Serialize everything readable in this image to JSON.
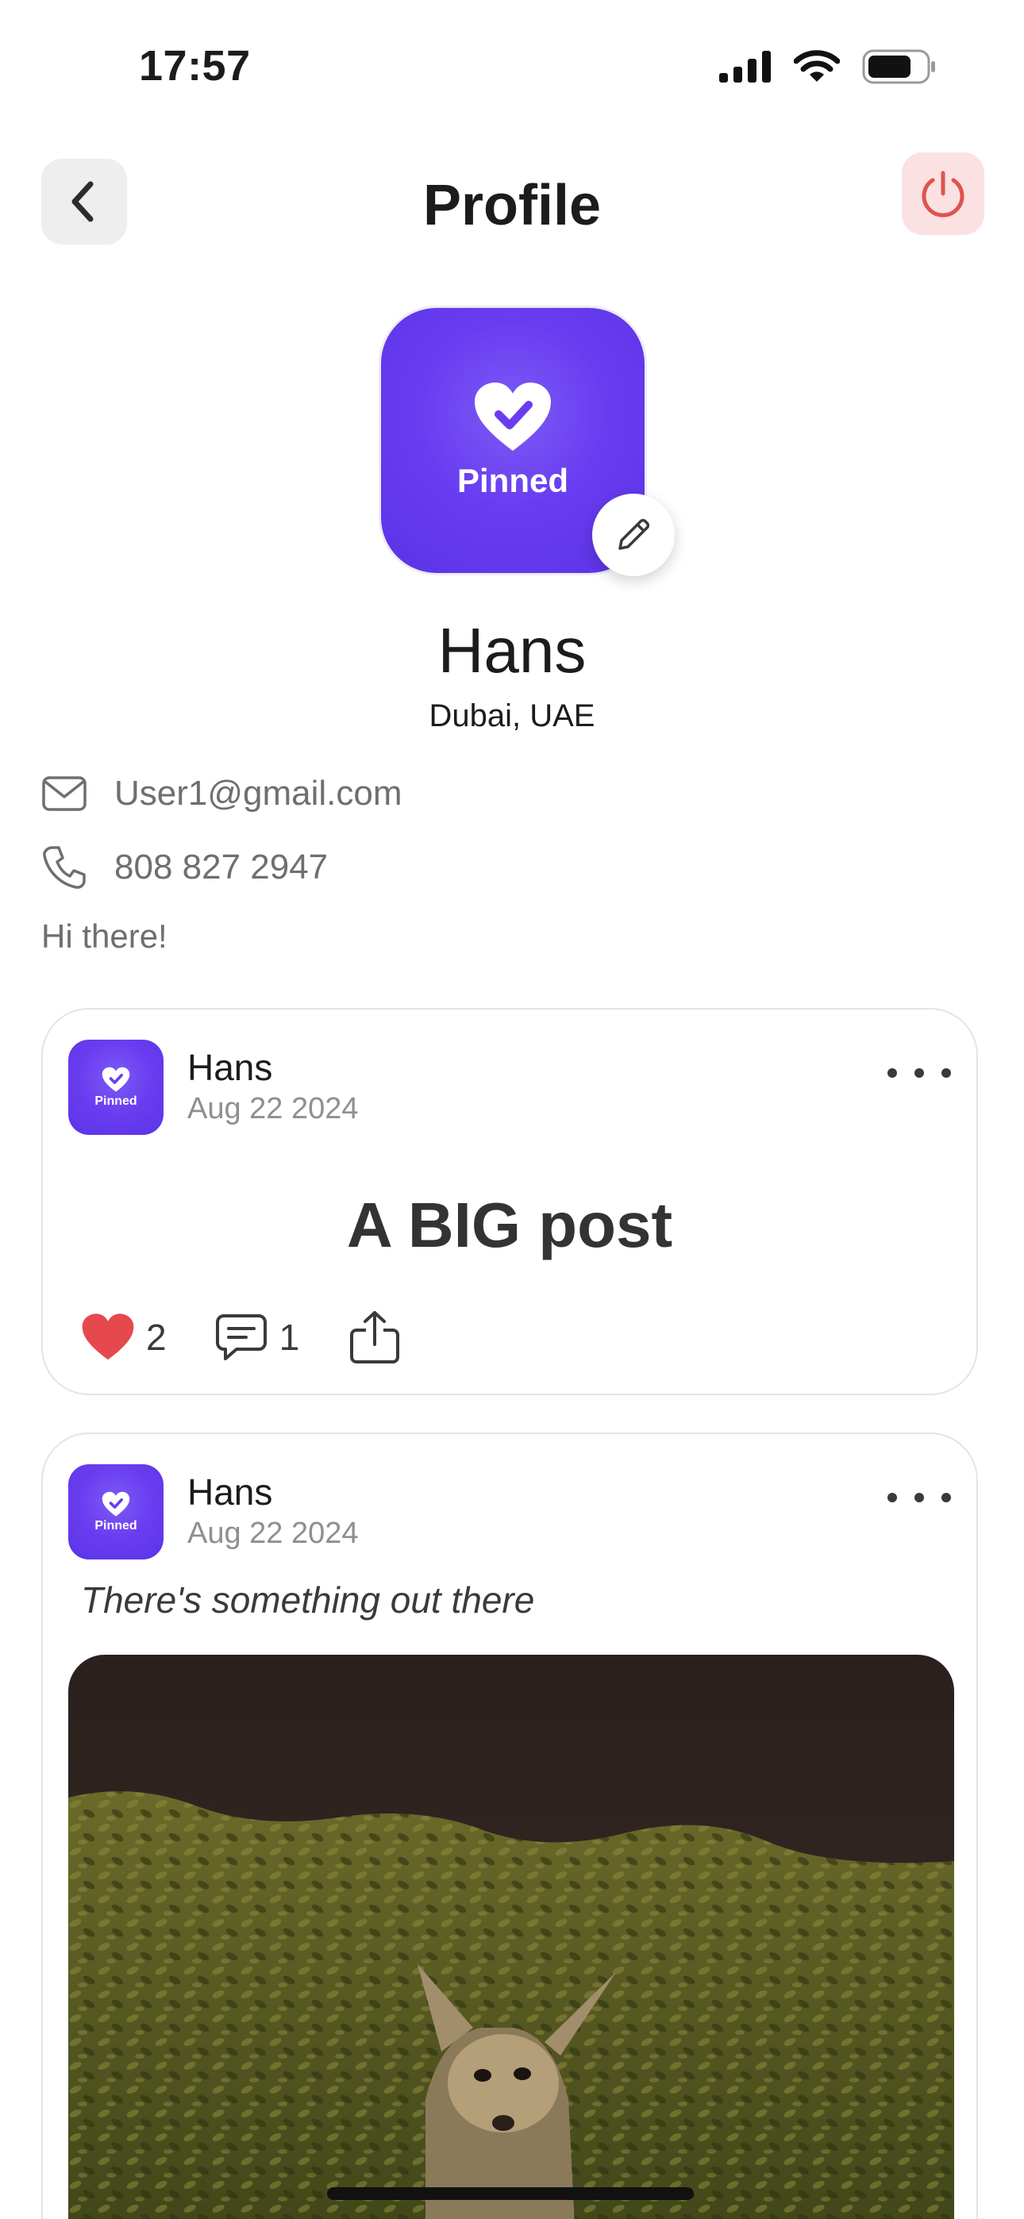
{
  "status_bar": {
    "time": "17:57",
    "battery_level": 0.75
  },
  "header": {
    "title": "Profile",
    "back_icon": "chevron-left-icon",
    "logout_icon": "power-icon",
    "logout_color": "#e05252"
  },
  "profile": {
    "avatar_label": "Pinned",
    "name": "Hans",
    "location": "Dubai, UAE",
    "email": "User1@gmail.com",
    "phone": "808 827 2947",
    "bio": "Hi there!"
  },
  "colors": {
    "brand": "#6a3cf0",
    "like": "#e5484d",
    "muted": "#8e8e93"
  },
  "posts": [
    {
      "avatar_label": "Pinned",
      "author": "Hans",
      "date": "Aug 22 2024",
      "headline": "A BIG post",
      "likes": "2",
      "comments": "1"
    },
    {
      "avatar_label": "Pinned",
      "author": "Hans",
      "date": "Aug 22 2024",
      "caption": "There's something out there"
    }
  ]
}
